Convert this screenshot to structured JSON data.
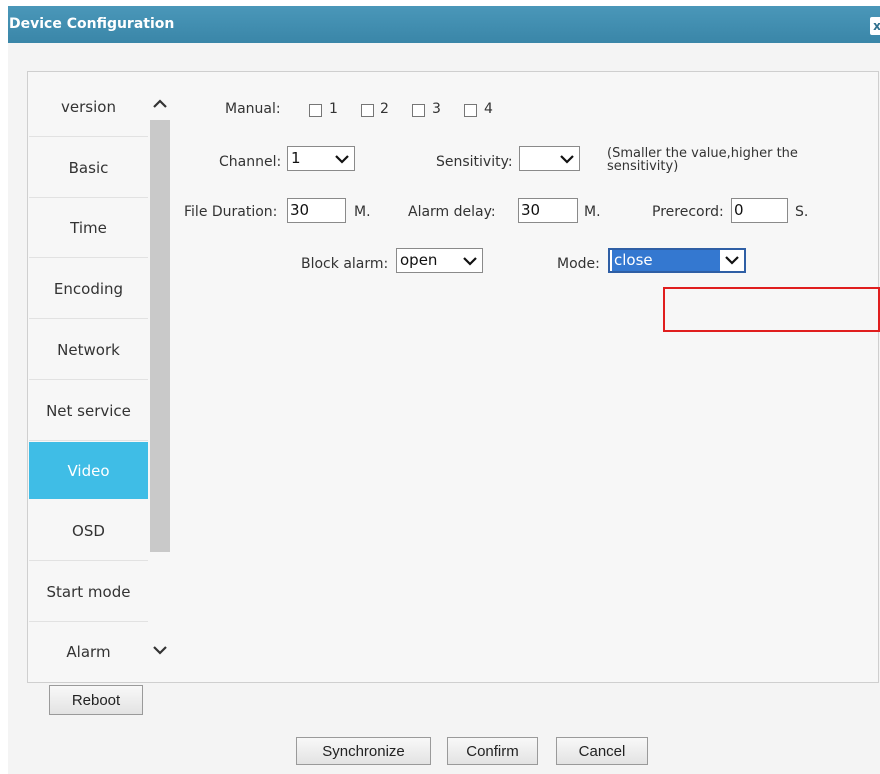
{
  "dialog": {
    "title": "Device Configuration",
    "close_glyph": "x"
  },
  "nav": {
    "items": [
      {
        "label": "version"
      },
      {
        "label": "Basic"
      },
      {
        "label": "Time"
      },
      {
        "label": "Encoding"
      },
      {
        "label": "Network"
      },
      {
        "label": "Net service"
      },
      {
        "label": "Video",
        "active": true
      },
      {
        "label": "OSD"
      },
      {
        "label": "Start mode"
      },
      {
        "label": "Alarm"
      }
    ]
  },
  "form": {
    "manual": {
      "label": "Manual:",
      "options": [
        "1",
        "2",
        "3",
        "4"
      ]
    },
    "channel": {
      "label": "Channel:",
      "value": "1"
    },
    "sensitivity": {
      "label": "Sensitivity:",
      "value": ""
    },
    "sensitivity_hint": {
      "line1": "(Smaller the value,higher the",
      "line2": "sensitivity)"
    },
    "file_duration": {
      "label": "File Duration:",
      "value": "30",
      "unit": "M."
    },
    "alarm_delay": {
      "label": "Alarm delay:",
      "value": "30",
      "unit": "M."
    },
    "prerecord": {
      "label": "Prerecord:",
      "value": "0",
      "unit": "S."
    },
    "block_alarm": {
      "label": "Block alarm:",
      "value": "open"
    },
    "mode": {
      "label": "Mode:",
      "value": "close"
    }
  },
  "buttons": {
    "reboot": "Reboot",
    "synchronize": "Synchronize",
    "confirm": "Confirm",
    "cancel": "Cancel"
  },
  "colors": {
    "titlebar": "#4290b3",
    "active_nav": "#3fbde6",
    "selection": "#3478d0",
    "highlight_box": "#e01e1e"
  }
}
